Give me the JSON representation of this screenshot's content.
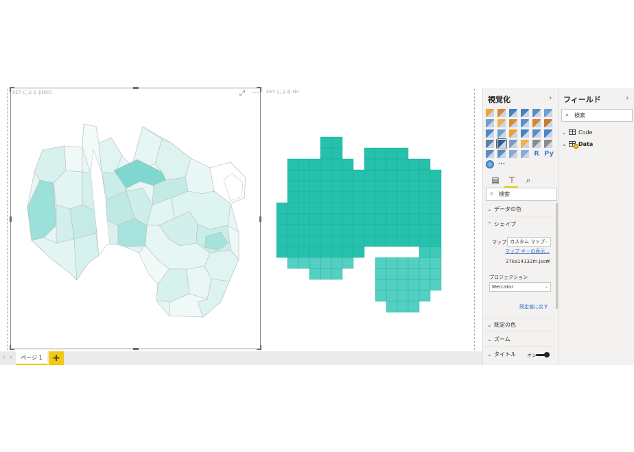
{
  "visuals": {
    "map1_title": "KEY による JINKO",
    "map2_title": "KEY による No"
  },
  "page_tabs": {
    "tabs": [
      "ページ 1"
    ],
    "add_label": "+"
  },
  "viz_pane": {
    "title": "視覚化",
    "search_placeholder": "検索",
    "sections": {
      "data_colors": "データの色",
      "shape": "シェイプ",
      "default_color": "既定の色",
      "zoom": "ズーム",
      "title": "タイトル"
    },
    "shape": {
      "map_label": "マップ",
      "map_value": "カスタム マップ",
      "map_keys_link": "マップ キーの表示...",
      "file_name": "27ka14132m.json",
      "projection_label": "プロジェクション",
      "projection_value": "Mercator",
      "reset_link": "既定値に戻す"
    },
    "title_toggle": "オン",
    "more_icon": "···"
  },
  "fields_pane": {
    "title": "フィールド",
    "search_placeholder": "検索",
    "tables": [
      "Code",
      "Data"
    ]
  },
  "colors": {
    "accent": "#f2c811",
    "hexmap_fill": "#2ec4b6",
    "choropleth_light": "#e8f6f5",
    "choropleth_dark": "#7dd8d0"
  }
}
